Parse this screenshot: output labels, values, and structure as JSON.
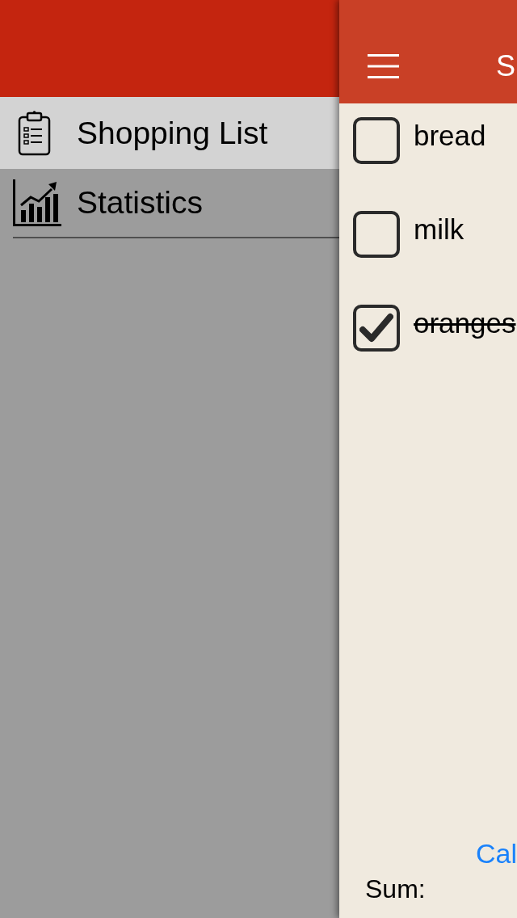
{
  "drawer": {
    "items": [
      {
        "label": "Shopping List",
        "selected": true,
        "kind": "list"
      },
      {
        "label": "Statistics",
        "selected": false,
        "kind": "chart"
      }
    ]
  },
  "header": {
    "title": "S"
  },
  "items": [
    {
      "name": "bread",
      "checked": false
    },
    {
      "name": "milk",
      "checked": false
    },
    {
      "name": "oranges",
      "checked": true
    }
  ],
  "footer": {
    "button": "Cal",
    "sum_label": "Sum:"
  }
}
